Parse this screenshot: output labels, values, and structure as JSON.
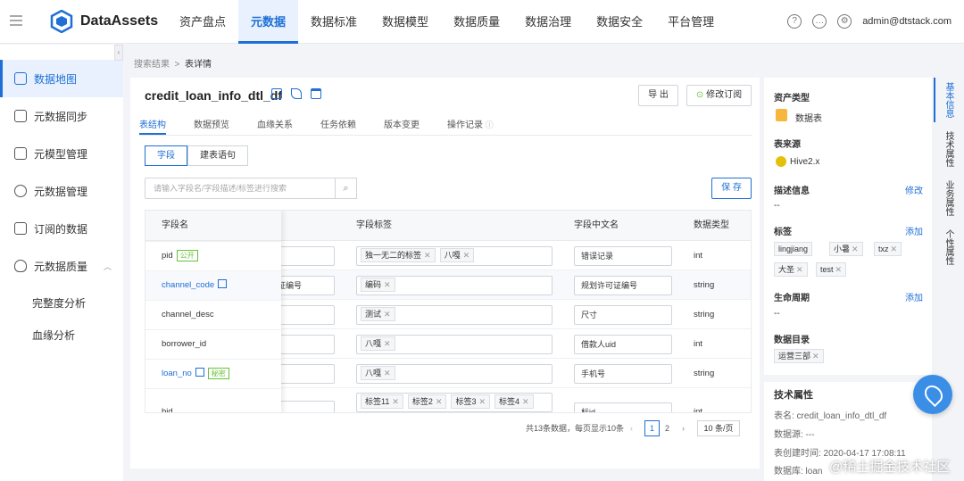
{
  "header": {
    "brand": "DataAssets",
    "nav": [
      "资产盘点",
      "元数据",
      "数据标准",
      "数据模型",
      "数据质量",
      "数据治理",
      "数据安全",
      "平台管理"
    ],
    "user": "admin@dtstack.com"
  },
  "sidebar": {
    "items": [
      "数据地图",
      "元数据同步",
      "元模型管理",
      "元数据管理",
      "订阅的数据",
      "元数据质量"
    ],
    "subitems": [
      "完整度分析",
      "血缘分析"
    ]
  },
  "breadcrumb": {
    "parent": "搜索结果",
    "current": "表详情"
  },
  "table_name": "credit_loan_info_dtl_df",
  "actions": {
    "export": "导 出",
    "subscribe": "修改订阅",
    "save": "保 存"
  },
  "tabs": [
    "表结构",
    "数据预览",
    "血缘关系",
    "任务依赖",
    "版本变更",
    "操作记录"
  ],
  "segment": [
    "字段",
    "建表语句"
  ],
  "search_placeholder": "请输入字段名/字段描述/标签进行搜索",
  "columns": [
    "字段名",
    "字段标签",
    "字段中文名",
    "数据类型"
  ],
  "rows": [
    {
      "name": "pid",
      "badge": "公开",
      "desc": "",
      "tags": [
        "独一无二的标签",
        "八嘎"
      ],
      "cn": "错误记录",
      "type": "int"
    },
    {
      "name": "channel_code",
      "badge": "",
      "desc": "证编号",
      "tags": [
        "编码"
      ],
      "cn": "规划许可证编号",
      "type": "string"
    },
    {
      "name": "channel_desc",
      "badge": "",
      "desc": "",
      "tags": [
        "测试"
      ],
      "cn": "尺寸",
      "type": "string"
    },
    {
      "name": "borrower_id",
      "badge": "",
      "desc": "",
      "tags": [
        "八嘎"
      ],
      "cn": "借款人uid",
      "type": "int"
    },
    {
      "name": "loan_no",
      "badge": "秘密",
      "desc": "",
      "tags": [
        "八嘎"
      ],
      "cn": "手机号",
      "type": "string"
    },
    {
      "name": "bid",
      "badge": "",
      "desc": "",
      "tags": [
        "标签11",
        "标签2",
        "标签3",
        "标签4"
      ],
      "cn": "标id",
      "type": "int"
    }
  ],
  "pagination": {
    "summary": "共13条数据，每页显示10条",
    "pages": [
      "1",
      "2"
    ],
    "page_size": "10 条/页"
  },
  "right": {
    "asset_type_label": "资产类型",
    "asset_type": "数据表",
    "source_label": "表来源",
    "source": "Hive2.x",
    "desc_label": "描述信息",
    "desc_edit": "修改",
    "desc": "--",
    "tags_label": "标签",
    "tags_add": "添加",
    "tags": [
      "lingjiang",
      "小暑",
      "txz",
      "大圣",
      "test"
    ],
    "life_label": "生命周期",
    "life_add": "添加",
    "life": "--",
    "catalog_label": "数据目录",
    "catalog": "运营三部",
    "tech_label": "技术属性",
    "tech_name": "表名: credit_loan_info_dtl_df",
    "tech_source": "数据源: ---",
    "tech_created": "表创建时间: 2020-04-17 17:08:11",
    "tech_db": "数据库: loan"
  },
  "vtabs": [
    "基本信息",
    "技术属性",
    "业务属性",
    "个性属性"
  ],
  "watermark": "@稀土掘金技术社区"
}
